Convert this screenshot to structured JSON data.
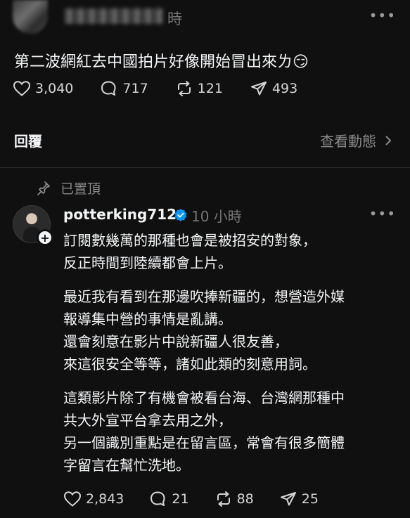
{
  "post": {
    "time": "時",
    "text": "第二波網紅去中國拍片好像開始冒出來ㄌ😏",
    "stats": {
      "likes": "3,040",
      "comments": "717",
      "reposts": "121",
      "shares": "493"
    },
    "more_icon": "more-icon"
  },
  "replies_section": {
    "label": "回覆",
    "view_activity": "查看動態"
  },
  "reply": {
    "pinned_label": "已置頂",
    "username": "potterking712",
    "time": "10 小時",
    "paragraphs": [
      [
        "訂閱數幾萬的那種也會是被招安的對象，",
        "反正時間到陸續都會上片。"
      ],
      [
        "最近我有看到在那邊吹捧新疆的，想營造外媒",
        "報導集中營的事情是亂講。",
        "還會刻意在影片中說新疆人很友善，",
        "來這很安全等等，諸如此類的刻意用詞。"
      ],
      [
        "這類影片除了有機會被看台海、台灣網那種中",
        "共大外宣平台拿去用之外，",
        "另一個識別重點是在留言區，常會有很多簡體",
        "字留言在幫忙洗地。"
      ]
    ],
    "stats": {
      "likes": "2,843",
      "comments": "21",
      "reposts": "88",
      "shares": "25"
    }
  },
  "colors": {
    "background": "#101010",
    "text": "#f3f5f7",
    "muted": "#8a8a8a",
    "verified": "#0095f6"
  }
}
